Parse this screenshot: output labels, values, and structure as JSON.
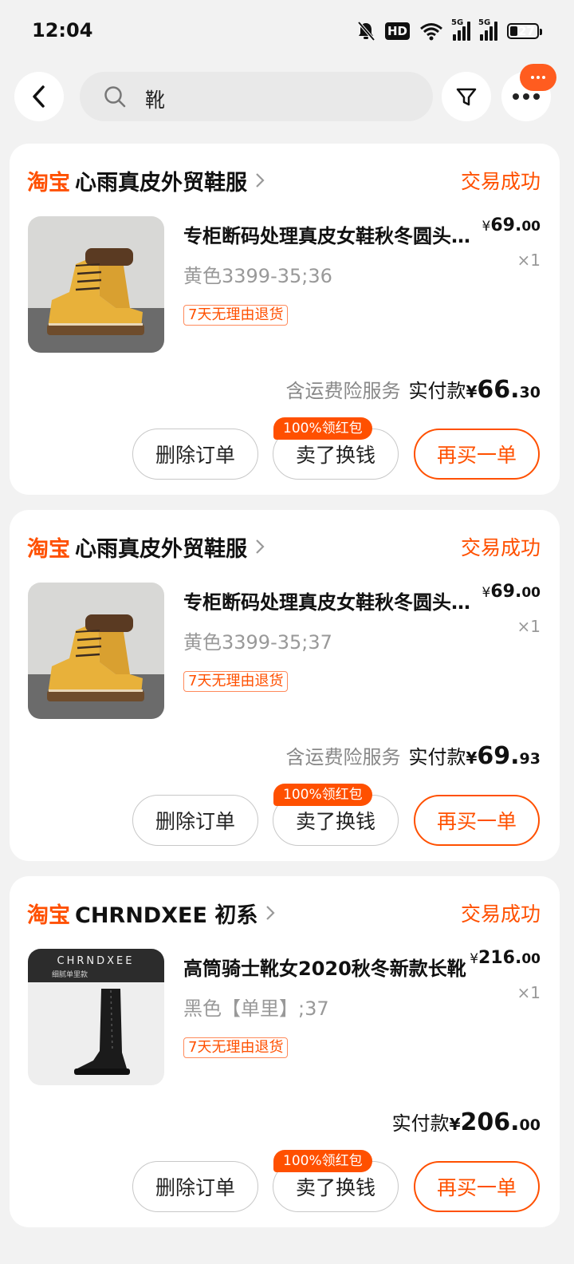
{
  "status_bar": {
    "time": "12:04",
    "hd": "HD",
    "sim1": "5G",
    "sim2": "5G",
    "battery": "27",
    "battery_level": 0.27,
    "icons": [
      "bell-off-icon",
      "wifi-icon",
      "signal-icon",
      "battery-icon"
    ]
  },
  "header": {
    "search_query": "靴",
    "icons": [
      "back-arrow-icon",
      "search-icon",
      "filter-icon",
      "more-icon"
    ]
  },
  "colors": {
    "accent": "#ff5000",
    "background": "#f2f2f2",
    "card": "#ffffff"
  },
  "orders": [
    {
      "platform": "淘宝",
      "shop_name": "心雨真皮外贸鞋服",
      "status": "交易成功",
      "product_title": "专柜断码处理真皮女鞋秋冬圆头短靴",
      "sku": "黄色3399-35;36",
      "return_tag": "7天无理由退货",
      "price_yen": "¥",
      "price_int": "69.",
      "price_dec": "00",
      "quantity": "×1",
      "insurance": "含运费险服务",
      "paid_label": "实付款",
      "paid_yen": "¥",
      "paid_int": "66.",
      "paid_dec": "30",
      "promo": "100%领红包",
      "buttons": {
        "delete": "删除订单",
        "sell": "卖了换钱",
        "rebuy": "再买一单"
      },
      "image": "yellow-boot-image"
    },
    {
      "platform": "淘宝",
      "shop_name": "心雨真皮外贸鞋服",
      "status": "交易成功",
      "product_title": "专柜断码处理真皮女鞋秋冬圆头短靴",
      "sku": "黄色3399-35;37",
      "return_tag": "7天无理由退货",
      "price_yen": "¥",
      "price_int": "69.",
      "price_dec": "00",
      "quantity": "×1",
      "insurance": "含运费险服务",
      "paid_label": "实付款",
      "paid_yen": "¥",
      "paid_int": "69.",
      "paid_dec": "93",
      "promo": "100%领红包",
      "buttons": {
        "delete": "删除订单",
        "sell": "卖了换钱",
        "rebuy": "再买一单"
      },
      "image": "yellow-boot-image"
    },
    {
      "platform": "淘宝",
      "shop_name": "CHRNDXEE 初系",
      "status": "交易成功",
      "product_title": "高筒骑士靴女2020秋冬新款长靴",
      "sku": "黑色【单里】;37",
      "return_tag": "7天无理由退货",
      "price_yen": "¥",
      "price_int": "216.",
      "price_dec": "00",
      "quantity": "×1",
      "insurance": "",
      "paid_label": "实付款",
      "paid_yen": "¥",
      "paid_int": "206.",
      "paid_dec": "00",
      "promo": "100%领红包",
      "image_brand": "CHRNDXEE",
      "image_caption": "细腻单里款",
      "buttons": {
        "delete": "删除订单",
        "sell": "卖了换钱",
        "rebuy": "再买一单"
      },
      "image": "black-knee-boot-image"
    }
  ]
}
